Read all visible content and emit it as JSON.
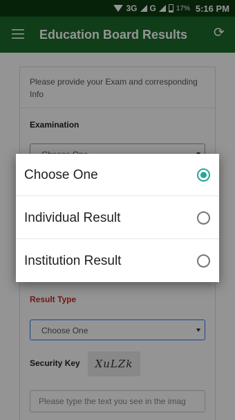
{
  "status_bar": {
    "network_1": "3G",
    "network_2": "G",
    "battery": "17%",
    "time": "5:16 PM"
  },
  "app_bar": {
    "title": "Education Board Results",
    "menu_icon": "hamburger-menu-icon",
    "refresh_icon": "refresh-icon"
  },
  "form": {
    "intro": "Please provide your Exam and corresponding Info",
    "examination_label": "Examination",
    "examination_value": "Choose One",
    "result_type_label": "Result Type",
    "result_type_value": "Choose One",
    "security_key_label": "Security Key",
    "captcha_text": "XuLZk",
    "captcha_placeholder": "Please type the text you see in the imag"
  },
  "dialog": {
    "options": [
      {
        "label": "Choose One",
        "selected": true
      },
      {
        "label": "Individual Result",
        "selected": false
      },
      {
        "label": "Institution Result",
        "selected": false
      }
    ]
  },
  "colors": {
    "status_bar": "#0b3d12",
    "app_bar": "#1b6b2a",
    "radio_accent": "#26a69a",
    "required_label": "#c62828"
  }
}
